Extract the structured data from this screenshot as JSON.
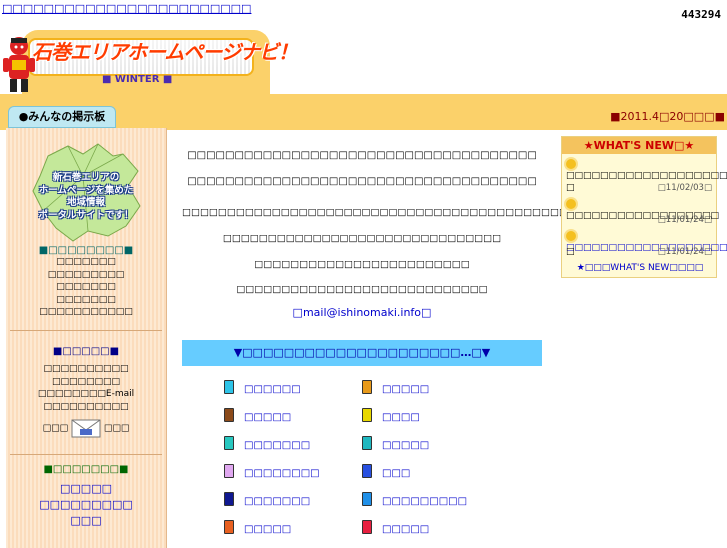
{
  "top": {
    "link_text": "□□□□□□□□□□□□□□□□□□□□□□□□",
    "counter": "443294"
  },
  "logo": {
    "title": "石巻エリアホームページナビ！",
    "subtitle": "■ WINTER ■"
  },
  "date_line": "■2011.4□20□□□■",
  "board_tab": "●みんなの掲示板",
  "sidebar": {
    "map_caption": [
      "新石巻エリアの",
      "ホームページを集めた",
      "地域情報",
      "ポータルサイトです！"
    ],
    "section1": {
      "title": "■□□□□□□□□■",
      "items": [
        "□□□□□□□",
        "□□□□□□□□□",
        "□□□□□□□",
        "□□□□□□□",
        "□□□□□□□□□□□"
      ]
    },
    "section2": {
      "title": "■□□□□□■",
      "items": [
        "□□□□□□□□□□",
        "□□□□□□□□",
        "□□□□□□□□E-mail",
        "□□□□□□□□□□"
      ],
      "mail_left": "□□□",
      "mail_right": "□□□"
    },
    "section3": {
      "title": "■□□□□□□□■",
      "items": [
        "□□□□□",
        "□□□□□□□□□",
        "□□□"
      ]
    }
  },
  "center": {
    "lines": [
      "□□□□□□□□□□□□□□□□□□□□□□□□□□□□□□□□□□□□□",
      "□□□□□□□□□□□□□□□□□□□□□□□□□□□□□□□□□□□□□",
      "□□□□□□□□□□□□□□□□□□□□□□□□□□□□□□□□□□□□□□□□□□□",
      "□□□□□□□□□□□□□□□□□□□□□□□□□□□□□□□",
      "□□□□□□□□□□□□□□□□□□□□□□□□",
      "□□□□□□□□□□□□□□□□□□□□□□□□□□□□"
    ],
    "mail": "□mail@ishinomaki.info□"
  },
  "menu_bar": "▼□□□□□□□□□□□□□□□□□□□□□…□▼",
  "categories": [
    {
      "label": "□□□□□□",
      "color": "#2ec4e8"
    },
    {
      "label": "□□□□□",
      "color": "#e89a1a"
    },
    {
      "label": "□□□□□",
      "color": "#8b4a1a"
    },
    {
      "label": "□□□□",
      "color": "#e8d800"
    },
    {
      "label": "□□□□□□□",
      "color": "#28c8c0"
    },
    {
      "label": "□□□□□",
      "color": "#20b8c0"
    },
    {
      "label": "□□□□□□□□",
      "color": "#e0a8f0"
    },
    {
      "label": "□□□",
      "color": "#2850e0"
    },
    {
      "label": "□□□□□□□",
      "color": "#101890"
    },
    {
      "label": "□□□□□□□□□",
      "color": "#2090e8"
    },
    {
      "label": "□□□□□",
      "color": "#e86020"
    },
    {
      "label": "□□□□□",
      "color": "#e82040"
    }
  ],
  "whats_new": {
    "title": "★WHAT'S NEW□★",
    "items": [
      {
        "text": "□□□□□□□□□□□□□□□□□□□□□□□",
        "tail": "□",
        "date": "□11/02/03□"
      },
      {
        "text": "□□□□□□□□□□□□□□□□□□",
        "tail": "",
        "date": "□11/01/24□"
      },
      {
        "text": "□□□□□□□□□□□□□□□□□□□□□",
        "tail": "□",
        "date": "□11/01/24□"
      }
    ],
    "footer": "★□□□WHAT'S NEW□□□□"
  }
}
